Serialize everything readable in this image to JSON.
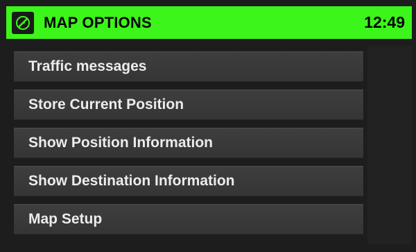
{
  "header": {
    "title": "MAP OPTIONS",
    "time": "12:49",
    "icon": "compass-icon",
    "accent_color": "#3cf51a"
  },
  "menu": {
    "items": [
      {
        "label": "Traffic messages"
      },
      {
        "label": "Store Current Position"
      },
      {
        "label": "Show Position Information"
      },
      {
        "label": "Show Destination Information"
      },
      {
        "label": "Map Setup"
      }
    ]
  }
}
